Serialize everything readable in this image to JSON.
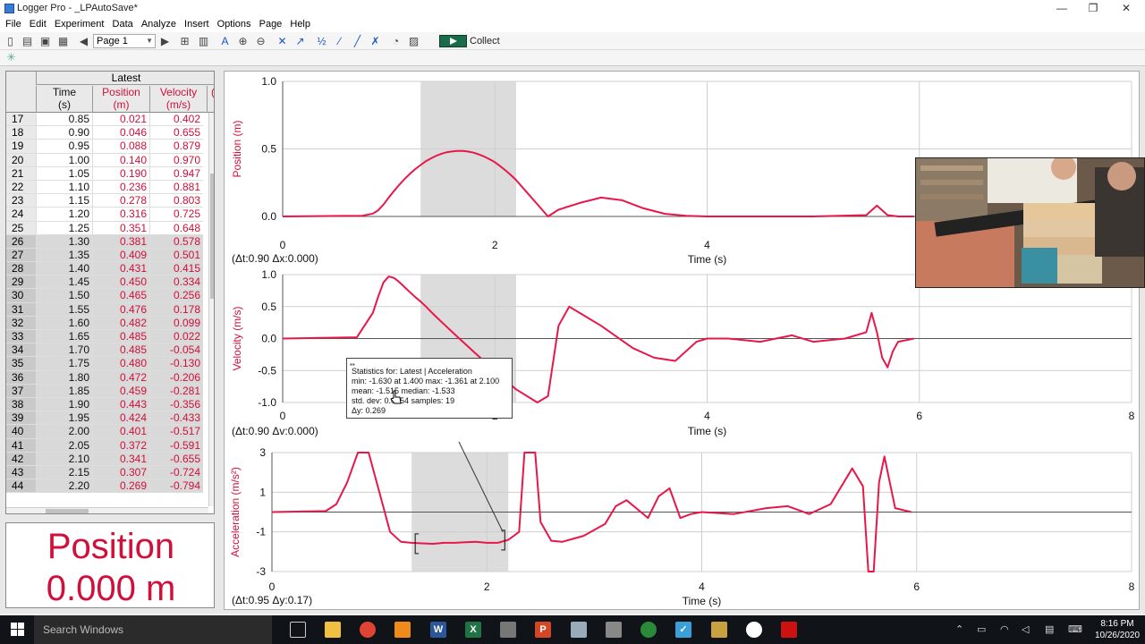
{
  "window": {
    "title": "Logger Pro - _LPAutoSave*",
    "minimize": "—",
    "restore": "❐",
    "close": "✕"
  },
  "menu": [
    "File",
    "Edit",
    "Experiment",
    "Data",
    "Analyze",
    "Insert",
    "Options",
    "Page",
    "Help"
  ],
  "toolbar": {
    "page_select": "Page 1",
    "collect_label": "Collect"
  },
  "table": {
    "dataset": "Latest",
    "columns": [
      {
        "name": "Time",
        "unit": "(s)"
      },
      {
        "name": "Position",
        "unit": "(m)"
      },
      {
        "name": "Velocity",
        "unit": "(m/s)"
      }
    ],
    "extra_col_marker": "(",
    "rows": [
      {
        "n": "17",
        "t": "0.85",
        "x": "0.021",
        "v": "0.402"
      },
      {
        "n": "18",
        "t": "0.90",
        "x": "0.046",
        "v": "0.655"
      },
      {
        "n": "19",
        "t": "0.95",
        "x": "0.088",
        "v": "0.879"
      },
      {
        "n": "20",
        "t": "1.00",
        "x": "0.140",
        "v": "0.970"
      },
      {
        "n": "21",
        "t": "1.05",
        "x": "0.190",
        "v": "0.947"
      },
      {
        "n": "22",
        "t": "1.10",
        "x": "0.236",
        "v": "0.881"
      },
      {
        "n": "23",
        "t": "1.15",
        "x": "0.278",
        "v": "0.803"
      },
      {
        "n": "24",
        "t": "1.20",
        "x": "0.316",
        "v": "0.725"
      },
      {
        "n": "25",
        "t": "1.25",
        "x": "0.351",
        "v": "0.648"
      },
      {
        "n": "26",
        "t": "1.30",
        "x": "0.381",
        "v": "0.578",
        "sel": true
      },
      {
        "n": "27",
        "t": "1.35",
        "x": "0.409",
        "v": "0.501",
        "sel": true
      },
      {
        "n": "28",
        "t": "1.40",
        "x": "0.431",
        "v": "0.415",
        "sel": true
      },
      {
        "n": "29",
        "t": "1.45",
        "x": "0.450",
        "v": "0.334",
        "sel": true
      },
      {
        "n": "30",
        "t": "1.50",
        "x": "0.465",
        "v": "0.256",
        "sel": true
      },
      {
        "n": "31",
        "t": "1.55",
        "x": "0.476",
        "v": "0.178",
        "sel": true
      },
      {
        "n": "32",
        "t": "1.60",
        "x": "0.482",
        "v": "0.099",
        "sel": true
      },
      {
        "n": "33",
        "t": "1.65",
        "x": "0.485",
        "v": "0.022",
        "sel": true
      },
      {
        "n": "34",
        "t": "1.70",
        "x": "0.485",
        "v": "-0.054",
        "sel": true
      },
      {
        "n": "35",
        "t": "1.75",
        "x": "0.480",
        "v": "-0.130",
        "sel": true
      },
      {
        "n": "36",
        "t": "1.80",
        "x": "0.472",
        "v": "-0.206",
        "sel": true
      },
      {
        "n": "37",
        "t": "1.85",
        "x": "0.459",
        "v": "-0.281",
        "sel": true
      },
      {
        "n": "38",
        "t": "1.90",
        "x": "0.443",
        "v": "-0.356",
        "sel": true
      },
      {
        "n": "39",
        "t": "1.95",
        "x": "0.424",
        "v": "-0.433",
        "sel": true
      },
      {
        "n": "40",
        "t": "2.00",
        "x": "0.401",
        "v": "-0.517",
        "sel": true
      },
      {
        "n": "41",
        "t": "2.05",
        "x": "0.372",
        "v": "-0.591",
        "sel": true
      },
      {
        "n": "42",
        "t": "2.10",
        "x": "0.341",
        "v": "-0.655",
        "sel": true
      },
      {
        "n": "43",
        "t": "2.15",
        "x": "0.307",
        "v": "-0.724",
        "sel": true
      },
      {
        "n": "44",
        "t": "2.20",
        "x": "0.269",
        "v": "-0.794",
        "sel": true
      }
    ]
  },
  "meter": {
    "label": "Position",
    "value": "0.000 m"
  },
  "chart_data": [
    {
      "type": "line",
      "ylabel": "Position (m)",
      "xlabel": "Time (s)",
      "xlim": [
        0,
        8
      ],
      "ylim": [
        0,
        1
      ],
      "xticks": [
        "0",
        "2",
        "4"
      ],
      "yticks": [
        "0.0",
        "0.5",
        "1.0"
      ],
      "selection": [
        1.3,
        2.2
      ],
      "delta_label": "(Δt:0.90 Δx:0.000)",
      "series": [
        {
          "color": "#e8174a",
          "x": [
            0,
            0.75,
            0.85,
            0.9,
            0.95,
            1.0,
            1.05,
            1.1,
            1.15,
            1.2,
            1.25,
            1.3,
            1.35,
            1.4,
            1.45,
            1.5,
            1.55,
            1.6,
            1.65,
            1.7,
            1.75,
            1.8,
            1.85,
            1.9,
            1.95,
            2.0,
            2.05,
            2.1,
            2.15,
            2.2,
            2.3,
            2.4,
            2.5,
            2.6,
            2.8,
            3.0,
            3.2,
            3.4,
            3.6,
            3.8,
            4.0,
            5.0,
            5.5,
            5.6,
            5.7,
            5.8,
            5.95
          ],
          "y": [
            0,
            0.005,
            0.021,
            0.046,
            0.088,
            0.14,
            0.19,
            0.236,
            0.278,
            0.316,
            0.351,
            0.381,
            0.409,
            0.431,
            0.45,
            0.465,
            0.476,
            0.482,
            0.485,
            0.485,
            0.48,
            0.472,
            0.459,
            0.443,
            0.424,
            0.401,
            0.372,
            0.341,
            0.307,
            0.269,
            0.18,
            0.09,
            0.0,
            0.05,
            0.1,
            0.14,
            0.12,
            0.06,
            0.02,
            0.005,
            0.0,
            0.0,
            0.01,
            0.08,
            0.01,
            0.0,
            0.0
          ]
        }
      ]
    },
    {
      "type": "line",
      "ylabel": "Velocity (m/s)",
      "xlabel": "Time (s)",
      "xlim": [
        0,
        8
      ],
      "ylim": [
        -1,
        1
      ],
      "xticks": [
        "0",
        "2",
        "4",
        "6",
        "8"
      ],
      "yticks": [
        "-1.0",
        "-0.5",
        "0.0",
        "0.5",
        "1.0"
      ],
      "selection": [
        1.3,
        2.2
      ],
      "delta_label": "(Δt:0.90 Δv:0.000)",
      "series": [
        {
          "color": "#e8174a",
          "x": [
            0,
            0.7,
            0.85,
            0.9,
            0.95,
            1.0,
            1.05,
            1.1,
            1.15,
            1.2,
            1.25,
            1.3,
            1.35,
            1.4,
            1.45,
            1.5,
            1.55,
            1.6,
            1.65,
            1.7,
            1.75,
            1.8,
            1.85,
            1.9,
            1.95,
            2.0,
            2.05,
            2.1,
            2.15,
            2.2,
            2.4,
            2.5,
            2.6,
            2.7,
            2.8,
            3.0,
            3.3,
            3.5,
            3.7,
            3.9,
            4.0,
            4.2,
            4.5,
            4.8,
            5.0,
            5.3,
            5.5,
            5.55,
            5.6,
            5.65,
            5.7,
            5.75,
            5.8,
            5.95
          ],
          "y": [
            0,
            0.02,
            0.402,
            0.655,
            0.879,
            0.97,
            0.947,
            0.881,
            0.803,
            0.725,
            0.648,
            0.578,
            0.501,
            0.415,
            0.334,
            0.256,
            0.178,
            0.099,
            0.022,
            -0.054,
            -0.13,
            -0.206,
            -0.281,
            -0.356,
            -0.433,
            -0.517,
            -0.591,
            -0.655,
            -0.724,
            -0.794,
            -1.0,
            -0.9,
            0.2,
            0.5,
            0.4,
            0.2,
            -0.15,
            -0.3,
            -0.35,
            -0.05,
            0.0,
            0.0,
            -0.05,
            0.05,
            -0.05,
            0.0,
            0.1,
            0.4,
            0.1,
            -0.3,
            -0.45,
            -0.2,
            -0.05,
            0.0
          ]
        }
      ]
    },
    {
      "type": "line",
      "ylabel": "Acceleration (m/s²)",
      "xlabel": "Time (s)",
      "xlim": [
        0,
        8
      ],
      "ylim": [
        -3,
        3
      ],
      "xticks": [
        "0",
        "2",
        "4",
        "6",
        "8"
      ],
      "yticks": [
        "-3",
        "-1",
        "1",
        "3"
      ],
      "selection": [
        1.3,
        2.2
      ],
      "delta_label": "(Δt:0.95 Δy:0.17)",
      "series": [
        {
          "color": "#e8174a",
          "x": [
            0,
            0.5,
            0.6,
            0.7,
            0.8,
            0.9,
            1.0,
            1.1,
            1.2,
            1.3,
            1.4,
            1.5,
            1.6,
            1.7,
            1.8,
            1.9,
            2.0,
            2.1,
            2.2,
            2.3,
            2.35,
            2.45,
            2.5,
            2.6,
            2.7,
            2.9,
            3.1,
            3.2,
            3.3,
            3.5,
            3.6,
            3.7,
            3.8,
            3.9,
            4.0,
            4.3,
            4.6,
            4.8,
            5.0,
            5.2,
            5.4,
            5.5,
            5.55,
            5.6,
            5.65,
            5.7,
            5.8,
            5.95
          ],
          "y": [
            0,
            0.05,
            0.4,
            1.5,
            3.2,
            3.5,
            1.0,
            -1.0,
            -1.5,
            -1.55,
            -1.58,
            -1.6,
            -1.55,
            -1.55,
            -1.52,
            -1.5,
            -1.55,
            -1.55,
            -1.4,
            -1.0,
            3.2,
            3.0,
            -0.5,
            -1.45,
            -1.5,
            -1.2,
            -0.6,
            0.3,
            0.6,
            -0.3,
            0.8,
            1.2,
            -0.3,
            -0.1,
            0.0,
            -0.1,
            0.2,
            0.3,
            -0.1,
            0.4,
            2.2,
            1.3,
            -3.5,
            -3.5,
            1.5,
            2.8,
            0.2,
            0.0
          ]
        }
      ]
    }
  ],
  "stats": {
    "title": "Statistics for: Latest | Acceleration",
    "line1": "min: -1.630 at 1.400 max: -1.361 at 2.100",
    "line2": "mean: -1.515 median: -1.533",
    "line3": "std. dev: 0.0654 samples: 19",
    "line4": "Δy: 0.269"
  },
  "taskbar": {
    "search_placeholder": "Search Windows",
    "time": "8:16 PM",
    "date": "10/26/2020"
  }
}
